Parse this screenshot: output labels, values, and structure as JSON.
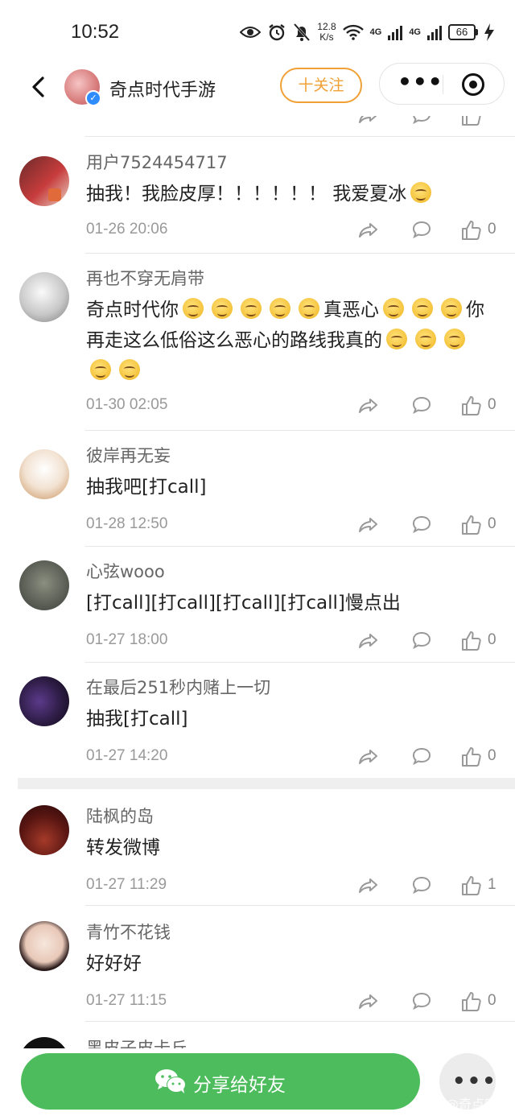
{
  "status_bar": {
    "time": "10:52",
    "net_speed_value": "12.8",
    "net_speed_unit": "K/s",
    "net1": "4G",
    "net2": "4G",
    "battery": "66"
  },
  "header": {
    "title": "奇点时代手游",
    "follow_label": "十关注"
  },
  "comments": [
    {
      "username": "用户7524454717",
      "text": "抽我！我脸皮厚！！！！！！ 我爱夏冰",
      "date": "01-26 20:06",
      "likes": "0"
    },
    {
      "username": "再也不穿无肩带",
      "text_parts": [
        "奇点时代你",
        "真恶心",
        "你再走这么低俗这么恶心的路线我真的"
      ],
      "date": "01-30 02:05",
      "likes": "0"
    },
    {
      "username": "彼岸再无妄",
      "text": "抽我吧[打call]",
      "date": "01-28 12:50",
      "likes": "0"
    },
    {
      "username": "心弦wooo",
      "text": "[打call][打call][打call][打call]慢点出",
      "date": "01-27 18:00",
      "likes": "0"
    },
    {
      "username": "在最后251秒内赌上一切",
      "text": "抽我[打call]",
      "date": "01-27 14:20",
      "likes": "0"
    },
    {
      "username": "陆枫的岛",
      "text": "转发微博",
      "date": "01-27 11:29",
      "likes": "1"
    },
    {
      "username": "青竹不花钱",
      "text": "好好好",
      "date": "01-27 11:15",
      "likes": "0"
    },
    {
      "username": "黑皮子皮卡丘"
    }
  ],
  "bottom_bar": {
    "share_label": "分享给好友",
    "watermark": "@奇点时代"
  },
  "icons": {
    "share": "share-icon",
    "reply": "comment-icon",
    "like": "thumbs-up-icon"
  },
  "colors": {
    "follow": "#f0a034",
    "share_button": "#4cbc5c",
    "verified": "#2f8cff"
  }
}
